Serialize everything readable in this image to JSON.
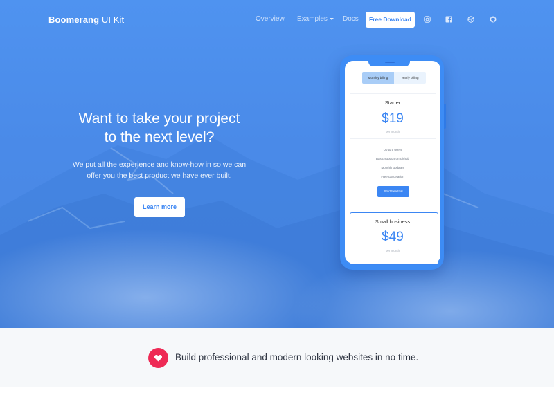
{
  "nav": {
    "brand_bold": "Boomerang",
    "brand_light": " UI Kit",
    "links": {
      "overview": "Overview",
      "examples": "Examples",
      "docs": "Docs"
    },
    "download_label": "Free Download",
    "social_icons": [
      "instagram-icon",
      "facebook-icon",
      "dribbble-icon",
      "github-icon"
    ]
  },
  "hero": {
    "title_line1": "Want to take your project",
    "title_line2": "to the next level?",
    "subtitle_line1": "We put all the experience and know-how in so we can",
    "subtitle_line2": "offer you the best product we have ever built.",
    "cta_label": "Learn more"
  },
  "phone": {
    "billing_toggle": {
      "monthly": "Monthly billing",
      "yearly": "Yearly billing",
      "selected": "monthly"
    },
    "plans": [
      {
        "name": "Starter",
        "price": "$19",
        "period": "per month",
        "features": [
          "Up to 5 users",
          "Basic support on Github",
          "Monthly updates",
          "Free cancelation"
        ],
        "cta": "Start free trial"
      },
      {
        "name": "Small business",
        "price": "$49",
        "period": "per month"
      }
    ]
  },
  "strip": {
    "icon": "heart-icon",
    "tagline": "Build professional and modern looking websites in no time."
  },
  "colors": {
    "primary": "#3b86f3",
    "hero_bg": "#4a8ae8",
    "heart": "#ee2a55",
    "strip_bg": "#f6f8fa"
  }
}
